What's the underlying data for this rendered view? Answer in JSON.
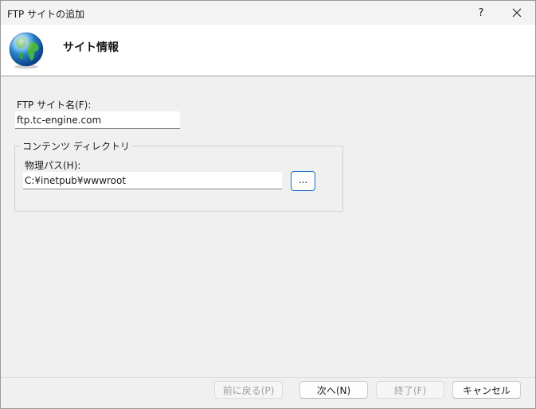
{
  "window": {
    "title": "FTP サイトの追加",
    "help_label": "?",
    "close_icon": "close-icon"
  },
  "header": {
    "heading": "サイト情報",
    "icon": "globe-icon"
  },
  "form": {
    "site_name_label": "FTP サイト名(F):",
    "site_name_value": "ftp.tc-engine.com",
    "content_group_label": "コンテンツ ディレクトリ",
    "physical_path_label": "物理パス(H):",
    "physical_path_value": "C:¥inetpub¥wwwroot",
    "browse_label": "..."
  },
  "footer": {
    "back_label": "前に戻る(P)",
    "next_label": "次へ(N)",
    "finish_label": "終了(F)",
    "cancel_label": "キャンセル"
  }
}
